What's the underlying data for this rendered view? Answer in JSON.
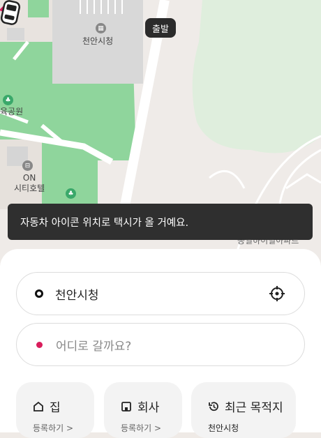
{
  "map": {
    "labels": {
      "city_hall": "천안시청",
      "park": "육공원",
      "hotel_line1": "ON",
      "hotel_line2": "시티호텔",
      "apartment": "동일하이빌아파트"
    },
    "depart_tag": "출발",
    "colors": {
      "accent": "#d91d5c",
      "park": "#8fd59c",
      "road": "#ffffff"
    }
  },
  "toast": {
    "message": "자동차 아이콘 위치로 택시가 올 거예요."
  },
  "origin": {
    "value": "천안시청",
    "icon": "target-icon"
  },
  "destination": {
    "placeholder": "어디로 갈까요?"
  },
  "shortcuts": [
    {
      "label": "집",
      "sub": "등록하기 >",
      "icon": "home-icon"
    },
    {
      "label": "회사",
      "sub": "등록하기 >",
      "icon": "building-icon"
    },
    {
      "label": "최근 목적지",
      "sub": "천안시청",
      "icon": "history-icon"
    }
  ]
}
